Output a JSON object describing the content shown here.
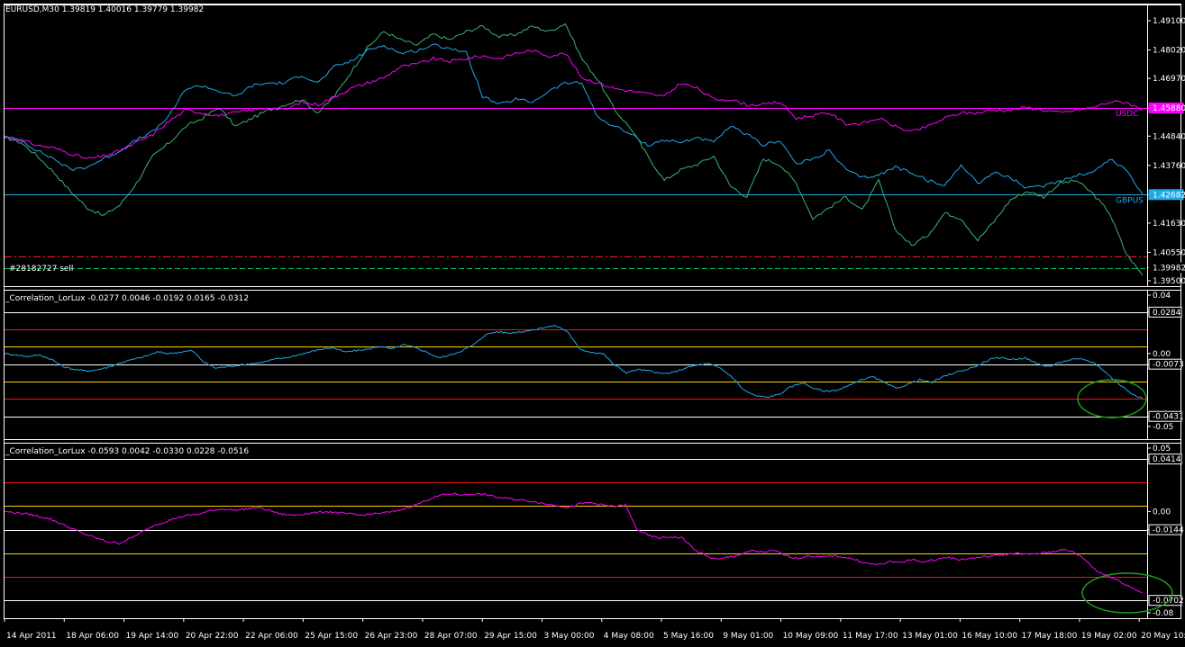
{
  "colors": {
    "background": "#000000",
    "frame": "#ffffff",
    "eurusd": "#3cb371",
    "gbpusd": "#1ea8e8",
    "usdchf": "#ff00ff",
    "red_level": "#ff1010",
    "yellow_level": "#ffd000",
    "ellipse": "#1f9b1f",
    "sell_line": "#00c060",
    "stop_line": "#ff2020"
  },
  "main_panel": {
    "header": "EURUSD,M30  1.39819 1.40016 1.39779 1.39982",
    "trade_label": "#28182727 sell",
    "usd_label": "USDC",
    "usd_value": "1.45880",
    "gbp_label": "GBPUS",
    "gbp_value": "1.42682",
    "price_current": "1.39982"
  },
  "corr_panel_1": {
    "header": "_Correlation_LorLux -0.0277 0.0046 -0.0192 0.0165 -0.0312",
    "box_top": "0.0284",
    "box_mid": "-0.0073",
    "box_bottom": "-0.0431"
  },
  "corr_panel_2": {
    "header": "_Correlation_LorLux -0.0593 0.0042 -0.0330 0.0228 -0.0516",
    "box_top": "0.0414",
    "box_mid": "-0.0144",
    "box_bottom": "-0.0702"
  },
  "chart_data": [
    {
      "type": "line",
      "panel": "main",
      "ylim": [
        1.395,
        1.495
      ],
      "yticks": [
        "1.49100",
        "1.48020",
        "1.46970",
        "1.45880",
        "1.44840",
        "1.43760",
        "1.42682",
        "1.41630",
        "1.40550",
        "1.39982",
        "1.39500"
      ],
      "ytick_values": [
        1.491,
        1.4802,
        1.4697,
        1.4588,
        1.4484,
        1.4376,
        1.4268,
        1.4163,
        1.4055,
        1.3998,
        1.395
      ],
      "series": [
        {
          "name": "EURUSD",
          "color_key": "eurusd",
          "values": [
            1.448,
            1.446,
            1.441,
            1.435,
            1.428,
            1.422,
            1.419,
            1.423,
            1.431,
            1.441,
            1.446,
            1.452,
            1.455,
            1.459,
            1.452,
            1.455,
            1.458,
            1.46,
            1.462,
            1.457,
            1.463,
            1.472,
            1.481,
            1.487,
            1.484,
            1.482,
            1.486,
            1.484,
            1.487,
            1.489,
            1.485,
            1.486,
            1.489,
            1.487,
            1.49,
            1.477,
            1.469,
            1.458,
            1.451,
            1.441,
            1.432,
            1.436,
            1.438,
            1.441,
            1.43,
            1.426,
            1.44,
            1.438,
            1.431,
            1.418,
            1.422,
            1.426,
            1.421,
            1.432,
            1.414,
            1.408,
            1.412,
            1.42,
            1.418,
            1.41,
            1.417,
            1.425,
            1.428,
            1.426,
            1.431,
            1.432,
            1.427,
            1.42,
            1.405,
            1.397
          ]
        },
        {
          "name": "GBPUSD",
          "color_key": "gbpusd",
          "values": [
            1.448,
            1.447,
            1.443,
            1.44,
            1.436,
            1.437,
            1.44,
            1.443,
            1.447,
            1.45,
            1.456,
            1.466,
            1.467,
            1.465,
            1.463,
            1.467,
            1.468,
            1.468,
            1.471,
            1.468,
            1.474,
            1.476,
            1.48,
            1.482,
            1.479,
            1.48,
            1.482,
            1.481,
            1.479,
            1.463,
            1.46,
            1.462,
            1.461,
            1.465,
            1.468,
            1.468,
            1.455,
            1.452,
            1.449,
            1.445,
            1.447,
            1.446,
            1.448,
            1.446,
            1.452,
            1.449,
            1.445,
            1.447,
            1.438,
            1.44,
            1.443,
            1.436,
            1.433,
            1.434,
            1.437,
            1.435,
            1.432,
            1.43,
            1.438,
            1.431,
            1.435,
            1.433,
            1.429,
            1.43,
            1.432,
            1.434,
            1.435,
            1.44,
            1.436,
            1.427
          ]
        },
        {
          "name": "USDCHF",
          "color_key": "usdchf",
          "values": [
            1.448,
            1.447,
            1.445,
            1.444,
            1.442,
            1.44,
            1.441,
            1.443,
            1.446,
            1.449,
            1.454,
            1.458,
            1.457,
            1.456,
            1.457,
            1.458,
            1.459,
            1.458,
            1.461,
            1.46,
            1.463,
            1.466,
            1.468,
            1.47,
            1.474,
            1.475,
            1.477,
            1.476,
            1.477,
            1.478,
            1.477,
            1.479,
            1.48,
            1.478,
            1.479,
            1.47,
            1.468,
            1.466,
            1.465,
            1.464,
            1.463,
            1.468,
            1.466,
            1.462,
            1.462,
            1.46,
            1.46,
            1.461,
            1.455,
            1.456,
            1.457,
            1.453,
            1.453,
            1.455,
            1.452,
            1.45,
            1.452,
            1.455,
            1.457,
            1.457,
            1.458,
            1.458,
            1.459,
            1.458,
            1.457,
            1.458,
            1.459,
            1.461,
            1.461,
            1.458
          ]
        }
      ],
      "levels": [
        {
          "name": "USDC",
          "value": 1.4588,
          "color_key": "usdchf",
          "style": "solid"
        },
        {
          "name": "GBPUS",
          "value": 1.4268,
          "color_key": "gbpusd",
          "style": "solid"
        },
        {
          "name": "stop",
          "value": 1.404,
          "color_key": "stop_line",
          "style": "dashdot"
        },
        {
          "name": "#28182727 sell",
          "value": 1.3998,
          "color_key": "sell_line",
          "style": "dashed"
        }
      ]
    },
    {
      "type": "line",
      "panel": "corr1",
      "ylim": [
        -0.055,
        0.04
      ],
      "yticks": [
        "0.04",
        "0.0284",
        "0.00",
        "-0.0073",
        "-0.0431",
        "-0.05"
      ],
      "ytick_values": [
        0.04,
        0.0284,
        0.0,
        -0.0073,
        -0.0431,
        -0.05
      ],
      "levels": [
        {
          "value": 0.0284,
          "color_key": "frame"
        },
        {
          "value": 0.0165,
          "color_key": "red_level"
        },
        {
          "value": 0.0046,
          "color_key": "yellow_level"
        },
        {
          "value": -0.0073,
          "color_key": "frame"
        },
        {
          "value": -0.0192,
          "color_key": "yellow_level"
        },
        {
          "value": -0.0312,
          "color_key": "red_level"
        },
        {
          "value": -0.0431,
          "color_key": "frame"
        }
      ],
      "series": [
        {
          "color_key": "gbpusd",
          "values": [
            0.0,
            -0.001,
            -0.002,
            -0.001,
            -0.004,
            -0.009,
            -0.011,
            -0.012,
            -0.011,
            -0.009,
            -0.006,
            -0.004,
            -0.002,
            0.001,
            0.0,
            0.001,
            0.002,
            -0.006,
            -0.01,
            -0.009,
            -0.008,
            -0.007,
            -0.006,
            -0.004,
            -0.003,
            -0.001,
            0.001,
            0.003,
            0.004,
            0.001,
            0.002,
            0.003,
            0.005,
            0.003,
            0.006,
            0.004,
            0.001,
            -0.003,
            -0.001,
            0.002,
            0.006,
            0.013,
            0.015,
            0.014,
            0.015,
            0.016,
            0.018,
            0.019,
            0.015,
            0.003,
            0.001,
            0.0,
            -0.008,
            -0.013,
            -0.011,
            -0.012,
            -0.014,
            -0.013,
            -0.01,
            -0.008,
            -0.007,
            -0.01,
            -0.016,
            -0.025,
            -0.029,
            -0.03,
            -0.028,
            -0.023,
            -0.02,
            -0.024,
            -0.026,
            -0.025,
            -0.022,
            -0.018,
            -0.016,
            -0.02,
            -0.024,
            -0.021,
            -0.018,
            -0.02,
            -0.016,
            -0.013,
            -0.011,
            -0.008,
            -0.004,
            -0.003,
            -0.004,
            -0.003,
            -0.007,
            -0.009,
            -0.006,
            -0.004,
            -0.004,
            -0.007,
            -0.014,
            -0.021,
            -0.027,
            -0.031
          ]
        }
      ]
    },
    {
      "type": "line",
      "panel": "corr2",
      "ylim": [
        -0.08,
        0.05
      ],
      "yticks": [
        "0.05",
        "0.0414",
        "0.00",
        "-0.0144",
        "-0.0702",
        "-0.08"
      ],
      "ytick_values": [
        0.05,
        0.0414,
        0.0,
        -0.0144,
        -0.0702,
        -0.08
      ],
      "levels": [
        {
          "value": 0.0414,
          "color_key": "frame"
        },
        {
          "value": 0.0228,
          "color_key": "red_level"
        },
        {
          "value": 0.0042,
          "color_key": "yellow_level"
        },
        {
          "value": -0.0144,
          "color_key": "frame"
        },
        {
          "value": -0.033,
          "color_key": "yellow_level"
        },
        {
          "value": -0.0516,
          "color_key": "red_level"
        },
        {
          "value": -0.0702,
          "color_key": "frame"
        }
      ],
      "series": [
        {
          "color_key": "usdchf",
          "values": [
            0.0,
            -0.001,
            -0.002,
            -0.004,
            -0.006,
            -0.01,
            -0.014,
            -0.018,
            -0.021,
            -0.024,
            -0.025,
            -0.021,
            -0.016,
            -0.011,
            -0.008,
            -0.005,
            -0.003,
            -0.002,
            0.001,
            0.002,
            0.001,
            0.002,
            0.003,
            0.001,
            -0.002,
            -0.003,
            -0.002,
            -0.001,
            0.0,
            -0.001,
            -0.002,
            -0.003,
            -0.002,
            -0.001,
            0.0,
            0.003,
            0.006,
            0.01,
            0.013,
            0.014,
            0.013,
            0.014,
            0.013,
            0.011,
            0.01,
            0.009,
            0.008,
            0.006,
            0.005,
            0.003,
            0.006,
            0.007,
            0.005,
            0.004,
            0.005,
            -0.014,
            -0.019,
            -0.021,
            -0.02,
            -0.021,
            -0.03,
            -0.035,
            -0.038,
            -0.036,
            -0.034,
            -0.031,
            -0.032,
            -0.031,
            -0.035,
            -0.037,
            -0.035,
            -0.036,
            -0.035,
            -0.036,
            -0.038,
            -0.041,
            -0.042,
            -0.04,
            -0.04,
            -0.038,
            -0.04,
            -0.038,
            -0.036,
            -0.038,
            -0.037,
            -0.036,
            -0.035,
            -0.034,
            -0.033,
            -0.034,
            -0.033,
            -0.032,
            -0.03,
            -0.032,
            -0.038,
            -0.047,
            -0.051,
            -0.055,
            -0.06,
            -0.064
          ]
        }
      ]
    }
  ],
  "x_axis": {
    "labels": [
      "14 Apr 2011",
      "18 Apr 06:00",
      "19 Apr 14:00",
      "20 Apr 22:00",
      "22 Apr 06:00",
      "25 Apr 15:00",
      "26 Apr 23:00",
      "28 Apr 07:00",
      "29 Apr 15:00",
      "3 May 00:00",
      "4 May 08:00",
      "5 May 16:00",
      "9 May 01:00",
      "10 May 09:00",
      "11 May 17:00",
      "13 May 01:00",
      "16 May 10:00",
      "17 May 18:00",
      "19 May 02:00",
      "20 May 10:00"
    ]
  }
}
